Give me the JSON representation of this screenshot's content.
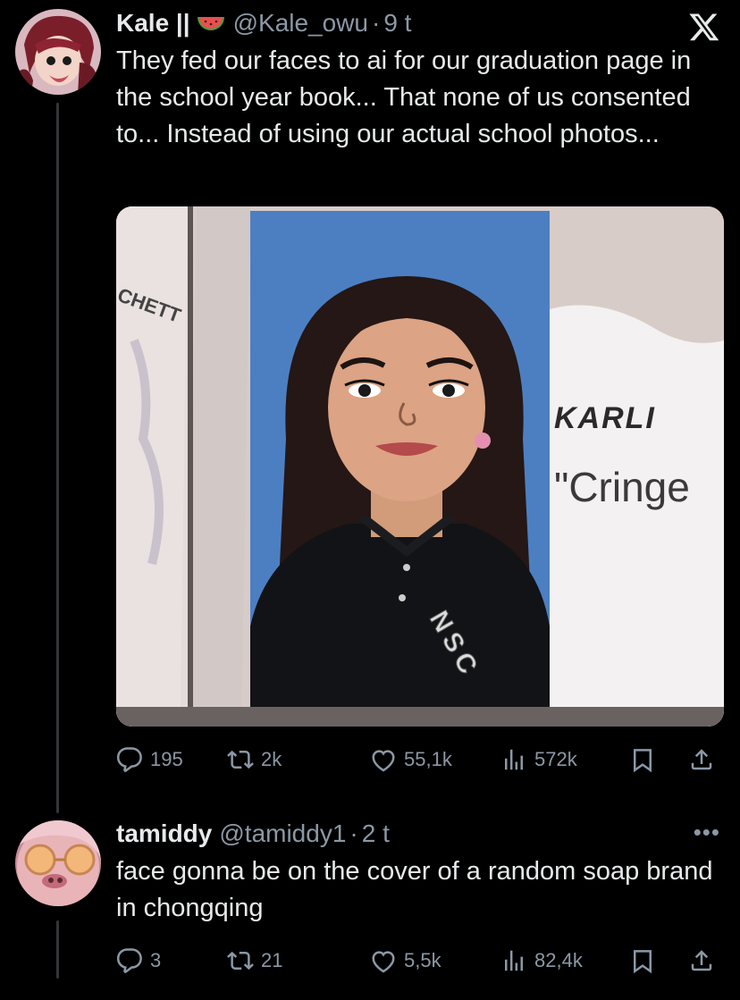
{
  "tweet": {
    "author_name": "Kale ||",
    "handle": "@Kale_owu",
    "separator": "·",
    "time": "9 t",
    "text": "They fed our faces to ai for our graduation page in the school year book... That none of us consented to... Instead of using our actual school photos...",
    "image_text": {
      "name": "KARLI",
      "quote": "\"Cringe",
      "edge_text": "CHETT",
      "jacket_letters": "NSC"
    },
    "stats": {
      "replies": "195",
      "retweets": "2k",
      "likes": "55,1k",
      "views": "572k"
    }
  },
  "reply": {
    "author_name": "tamiddy",
    "handle": "@tamiddy1",
    "separator": "·",
    "time": "2 t",
    "text": "face gonna be on the cover of a random soap brand in chongqing",
    "more": "•••",
    "stats": {
      "replies": "3",
      "retweets": "21",
      "likes": "5,5k",
      "views": "82,4k"
    }
  },
  "colors": {
    "background": "#000000",
    "text": "#e7e9ea",
    "muted": "#8b98a5",
    "thread_line": "#333639"
  },
  "icons": [
    "x-logo-icon",
    "watermelon-icon",
    "reply-icon",
    "retweet-icon",
    "like-icon",
    "views-icon",
    "bookmark-icon",
    "share-icon",
    "more-icon"
  ]
}
